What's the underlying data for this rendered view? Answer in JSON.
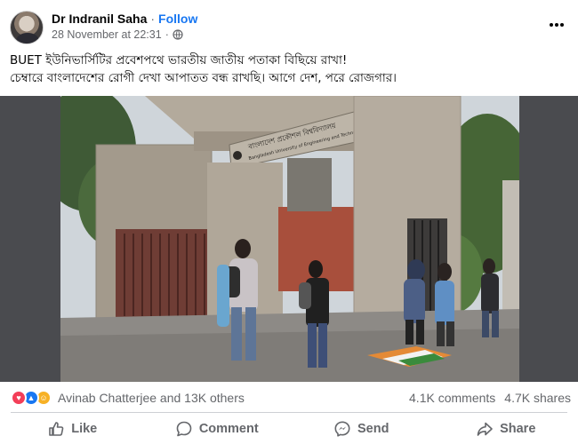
{
  "post": {
    "author": "Dr Indranil Saha",
    "separator": "·",
    "follow_label": "Follow",
    "timestamp": "28 November at 22:31",
    "timestamp_separator": "·",
    "privacy_icon": "globe-icon",
    "more_icon": "more-options-icon",
    "text_lines": [
      "BUET ইউনিভার্সিটির প্রবেশপথে ভারতীয় জাতীয় পতাকা বিছিয়ে রাখা!",
      "চেম্বারে বাংলাদেশের রোগী দেখা আপাতত বন্ধ রাখছি। আগে দেশ, পরে রোজগার।"
    ],
    "photo": {
      "gate_sign_bengali": "বাংলাদেশ প্রকৌশল বিশ্ববিদ্যালয়",
      "gate_sign_english": "Bangladesh University of Engineering and Technology"
    }
  },
  "engagement": {
    "reaction_icons": [
      "love",
      "like",
      "haha"
    ],
    "reactors": "Avinab Chatterjee and 13K others",
    "comments": "4.1K comments",
    "shares": "4.7K shares"
  },
  "actions": {
    "like": "Like",
    "comment": "Comment",
    "send": "Send",
    "share": "Share"
  },
  "colors": {
    "accent": "#1877f2",
    "secondary_text": "#65676b",
    "love": "#f33e58",
    "haha": "#f7b125"
  }
}
